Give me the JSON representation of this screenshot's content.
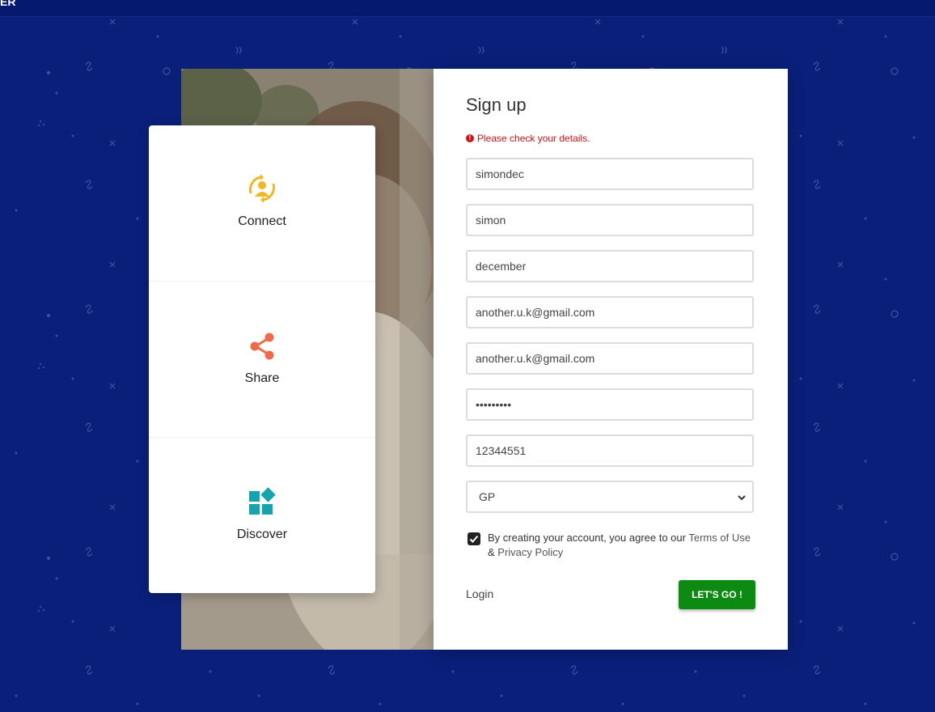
{
  "topbar": {
    "text": "ER"
  },
  "features": {
    "items": [
      {
        "label": "Connect",
        "icon": "connect-user-icon",
        "color": "#f3b81f"
      },
      {
        "label": "Share",
        "icon": "share-icon",
        "color": "#ef6a4b"
      },
      {
        "label": "Discover",
        "icon": "discover-grid-icon",
        "color": "#14a4ad"
      }
    ]
  },
  "form": {
    "title": "Sign up",
    "error": "Please check your details.",
    "fields": {
      "username": "simondec",
      "first_name": "simon",
      "last_name": "december",
      "email": "another.u.k@gmail.com",
      "email_confirm": "another.u.k@gmail.com",
      "password": "•••••••••",
      "phone": "12344551"
    },
    "select": {
      "value": "GP"
    },
    "terms": {
      "checked": true,
      "text_before": "By creating your account, you agree to our ",
      "terms_link": "Terms of Use",
      "separator": " & ",
      "privacy_link": "Privacy Policy"
    },
    "login_label": "Login",
    "submit_label": "LET'S GO !"
  },
  "colors": {
    "background": "#0a1f7a",
    "error": "#d0121b",
    "submit": "#0d8a12"
  }
}
